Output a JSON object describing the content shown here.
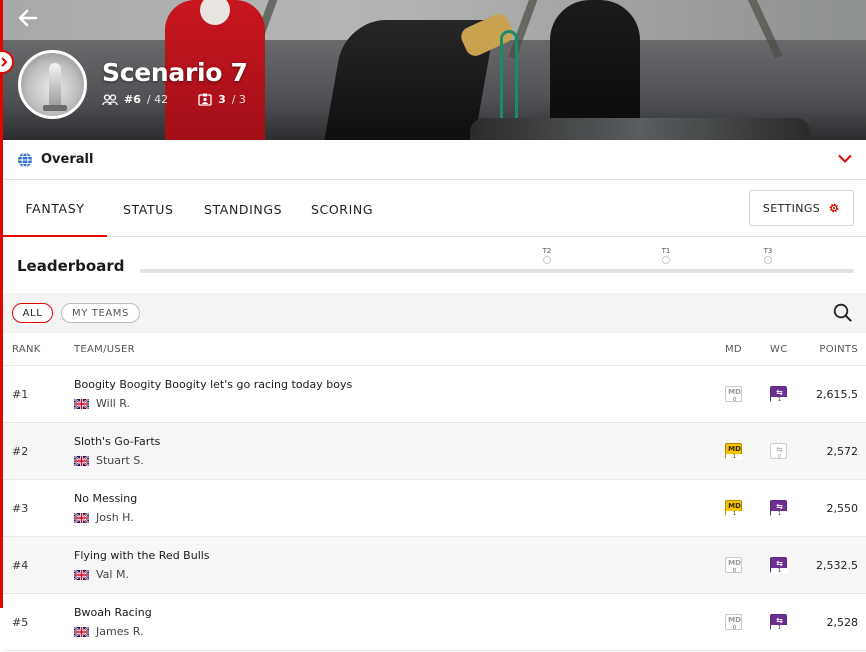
{
  "league": {
    "title": "Scenario 7",
    "rank": "#6",
    "total_teams": "/ 42",
    "teams_used": "3",
    "teams_max": "/ 3"
  },
  "overall": {
    "label": "Overall"
  },
  "tabs": [
    {
      "label": "FANTASY",
      "active": true
    },
    {
      "label": "STATUS",
      "active": false
    },
    {
      "label": "STANDINGS",
      "active": false
    },
    {
      "label": "SCORING",
      "active": false
    }
  ],
  "settings": {
    "label": "SETTINGS"
  },
  "leaderboard": {
    "title": "Leaderboard",
    "markers": [
      "T2",
      "T1",
      "T3"
    ]
  },
  "filters": {
    "all": "ALL",
    "my_teams": "MY TEAMS"
  },
  "columns": {
    "rank": "RANK",
    "team": "TEAM/USER",
    "md": "MD",
    "wc": "WC",
    "points": "POINTS"
  },
  "chips": {
    "md": "MD",
    "wc": "⇆"
  },
  "rows": [
    {
      "rank": "#1",
      "team": "Boogity Boogity Boogity let's go racing today boys",
      "user": "Will R.",
      "md_count": "0",
      "md_active": false,
      "wc_count": "1",
      "wc_active": true,
      "points": "2,615.5"
    },
    {
      "rank": "#2",
      "team": "Sloth's Go-Farts",
      "user": "Stuart S.",
      "md_count": "1",
      "md_active": true,
      "wc_count": "0",
      "wc_active": false,
      "points": "2,572"
    },
    {
      "rank": "#3",
      "team": "No Messing",
      "user": "Josh H.",
      "md_count": "1",
      "md_active": true,
      "wc_count": "1",
      "wc_active": true,
      "points": "2,550"
    },
    {
      "rank": "#4",
      "team": "Flying with the Red Bulls",
      "user": "Val M.",
      "md_count": "0",
      "md_active": false,
      "wc_count": "1",
      "wc_active": true,
      "points": "2,532.5"
    },
    {
      "rank": "#5",
      "team": "Bwoah Racing",
      "user": "James R.",
      "md_count": "0",
      "md_active": false,
      "wc_count": "1",
      "wc_active": true,
      "points": "2,528"
    }
  ],
  "colors": {
    "accent": "#e10600",
    "wildcard": "#6b2e92",
    "megadriver": "#f5c400"
  }
}
